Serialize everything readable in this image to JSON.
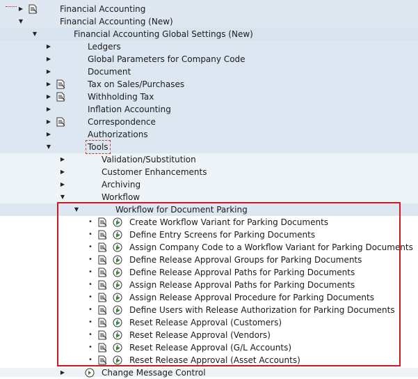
{
  "colors": {
    "band_level0": "#dfe8f0",
    "band_level1": "#d7e3ee",
    "band_level2": "#dde7f1",
    "band_level3": "#eef3f8",
    "band_white": "#ffffff",
    "highlight_box": "#d0191f"
  },
  "tree": {
    "financial_accounting": "Financial Accounting",
    "financial_accounting_new": "Financial Accounting (New)",
    "global_settings": "Financial Accounting Global Settings (New)",
    "ledgers": "Ledgers",
    "global_params": "Global Parameters for Company Code",
    "document": "Document",
    "tax": "Tax on Sales/Purchases",
    "withholding": "Withholding Tax",
    "inflation": "Inflation Accounting",
    "correspondence": "Correspondence",
    "authorizations": "Authorizations",
    "tools": "Tools",
    "validation": "Validation/Substitution",
    "customer_enh": "Customer Enhancements",
    "archiving": "Archiving",
    "workflow": "Workflow",
    "wf_parking": "Workflow for Document Parking",
    "activities": [
      "Create Workflow Variant for Parking Documents",
      "Define Entry Screens for Parking Documents",
      "Assign Company Code to a Workflow Variant for Parking Documents",
      "Define Release Approval Groups for Parking Documents",
      "Define Release Approval Paths for Parking Documents",
      "Assign Release Approval Paths for Parking Documents",
      "Assign Release Approval Procedure for Parking Documents",
      "Define Users with Release Authorization for Parking Documents",
      "Reset Release Approval (Customers)",
      "Reset Release Approval (Vendors)",
      "Reset Release Approval (G/L Accounts)",
      "Reset Release Approval (Asset Accounts)"
    ],
    "change_message_control": "Change Message Control"
  },
  "icons": {
    "expand": "triangle-right-icon",
    "collapse": "triangle-down-icon",
    "document": "document-icon",
    "activity": "clock-execute-icon"
  }
}
